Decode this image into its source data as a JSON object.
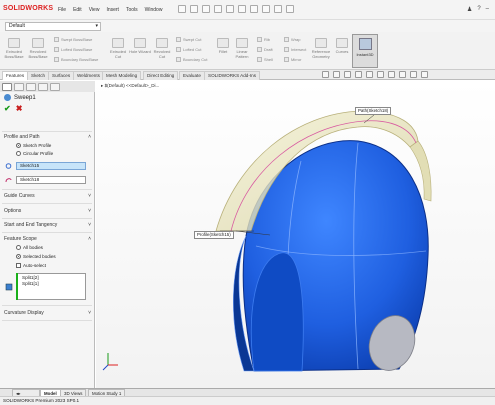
{
  "app": {
    "logo": "SOLIDWORKS"
  },
  "menu": [
    "File",
    "Edit",
    "View",
    "Insert",
    "Tools",
    "Window"
  ],
  "config": {
    "selected": "Default"
  },
  "commands": {
    "large": [
      "Extruded Boss/Base",
      "Revolved Boss/Base",
      "Extruded Cut",
      "Hole Wizard",
      "Revolved Cut",
      "Fillet",
      "Linear Pattern",
      "Rib",
      "Wrap",
      "Reference Geometry",
      "Curves",
      "Instant3D"
    ],
    "small": [
      "Swept Boss/Base",
      "Lofted Boss/Base",
      "Boundary Boss/Base",
      "Swept Cut",
      "Lofted Cut",
      "Boundary Cut",
      "Draft",
      "Intersect",
      "Shell",
      "Mirror"
    ]
  },
  "tabs": [
    "Features",
    "Sketch",
    "Surfaces",
    "Weldments",
    "Mesh Modeling",
    "Direct Editing",
    "Evaluate",
    "SOLIDWORKS Add-Ins"
  ],
  "property_manager": {
    "title": "Sweep1",
    "profile_path": {
      "header": "Profile and Path",
      "options": [
        "Sketch Profile",
        "Circular Profile"
      ],
      "profile": "Sketch15",
      "path": "Sketch18"
    },
    "sections": {
      "guide_curves": "Guide Curves",
      "options": "Options",
      "start_end": "Start and End Tangency",
      "feature_scope": "Feature Scope",
      "curvature": "Curvature Display"
    },
    "scope": {
      "options": [
        "All bodies",
        "Selected bodies"
      ],
      "auto_select": "Auto-select",
      "bodies": [
        "Split1[2]",
        "Split1[1]"
      ]
    }
  },
  "viewport": {
    "tree_item": "$(Default) <<Default>_Di...",
    "callout_path": "Path(Sketch18)",
    "callout_profile": "Profile(Sketch15)"
  },
  "bottom_tabs": [
    "Model",
    "3D Views",
    "Motion Study 1"
  ],
  "status": "SOLIDWORKS Premium 2023 SP0.1",
  "colors": {
    "helmet": "#1f5fe0",
    "sweep": "#e8e4b8",
    "accent": "#d22222"
  }
}
